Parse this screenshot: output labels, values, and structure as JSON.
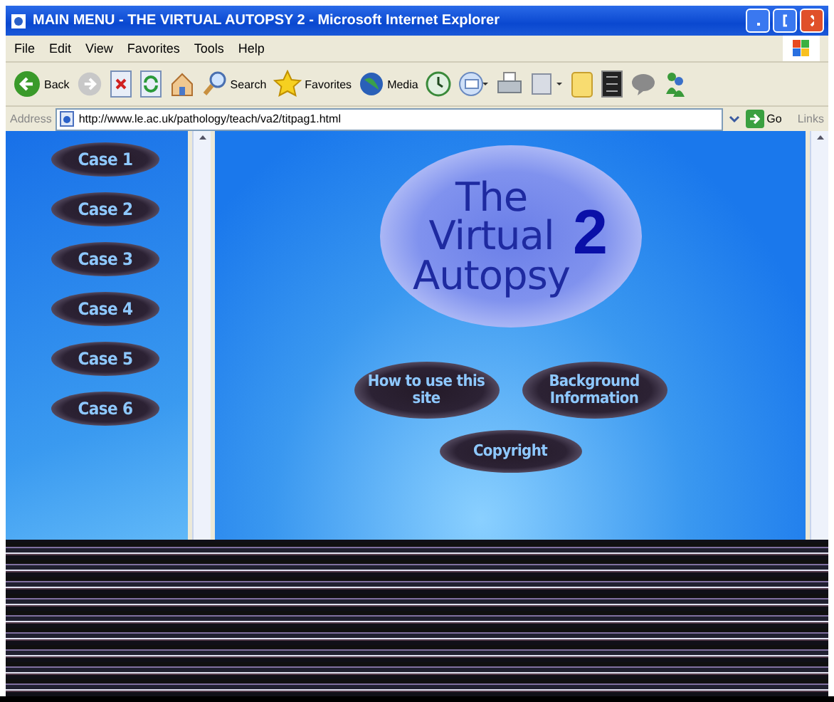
{
  "window": {
    "title": "MAIN MENU - THE VIRTUAL AUTOPSY 2 - Microsoft Internet Explorer"
  },
  "menu": [
    "File",
    "Edit",
    "View",
    "Favorites",
    "Tools",
    "Help"
  ],
  "toolbar": [
    {
      "kind": "back",
      "label": "Back"
    },
    {
      "kind": "forward"
    },
    {
      "kind": "stop"
    },
    {
      "kind": "refresh"
    },
    {
      "kind": "home"
    },
    {
      "kind": "search",
      "label": "Search"
    },
    {
      "kind": "favorites",
      "label": "Favorites"
    },
    {
      "kind": "media",
      "label": "Media"
    },
    {
      "kind": "history"
    },
    {
      "kind": "mail"
    },
    {
      "kind": "print"
    },
    {
      "kind": "edit"
    },
    {
      "kind": "folder"
    },
    {
      "kind": "square"
    },
    {
      "kind": "chat"
    },
    {
      "kind": "messenger"
    }
  ],
  "address": {
    "label": "Address",
    "url": "http://www.le.ac.uk/pathology/teach/va2/titpag1.html",
    "go": "Go",
    "links": "Links"
  },
  "sidebar": {
    "items": [
      {
        "label": "Case 1"
      },
      {
        "label": "Case 2"
      },
      {
        "label": "Case 3"
      },
      {
        "label": "Case 4"
      },
      {
        "label": "Case 5"
      },
      {
        "label": "Case 6"
      }
    ]
  },
  "logo": {
    "lines": [
      "The",
      "Virtual",
      "Autopsy"
    ],
    "number": "2"
  },
  "buttons": [
    "How to use this site",
    "Background Information",
    "Copyright"
  ]
}
